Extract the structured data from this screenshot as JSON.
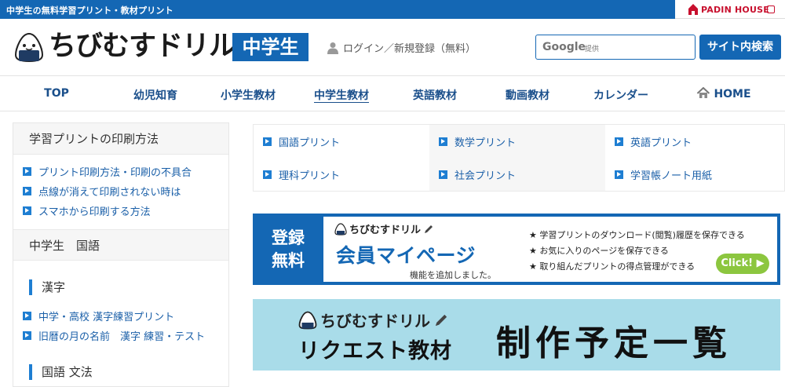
{
  "topbar": {
    "text": "中学生の無料学習プリント・教材プリント",
    "partner": "PADIN HOUSE"
  },
  "header": {
    "logo_text": "ちびむすドリル",
    "logo_badge": "中学生",
    "login_text": "ログイン／新規登録（無料）",
    "search_google": "Google",
    "search_provided": "提供",
    "search_button": "サイト内検索"
  },
  "nav": {
    "items": [
      "TOP",
      "幼児知育",
      "小学生教材",
      "中学生教材",
      "英語教材",
      "動画教材",
      "カレンダー",
      "HOME"
    ]
  },
  "sidebar": {
    "print_head": "学習プリントの印刷方法",
    "print_links": [
      "プリント印刷方法・印刷の不具合",
      "点線が消えて印刷されない時は",
      "スマホから印刷する方法"
    ],
    "subject_head": "中学生　国語",
    "kanji_title": "漢字",
    "kanji_links": [
      "中学・高校 漢字練習プリント",
      "旧暦の月の名前　漢字 練習・テスト"
    ],
    "grammar_title": "国語 文法"
  },
  "subjects": [
    "国語プリント",
    "数学プリント",
    "英語プリント",
    "理科プリント",
    "社会プリント",
    "学習帳ノート用紙"
  ],
  "banner_member": {
    "left_line1": "登録",
    "left_line2": "無料",
    "logo_text": "ちびむすドリル",
    "title": "会員マイページ",
    "caption": "機能を追加しました。",
    "features": [
      "★ 学習プリントのダウンロード(閲覧)履歴を保存できる",
      "★ お気に入りのページを保存できる",
      "★ 取り組んだプリントの得点管理ができる"
    ],
    "click_label": "Click! ▶"
  },
  "banner_request": {
    "logo_text": "ちびむすドリル",
    "title": "リクエスト教材",
    "big_text": "制作予定一覧"
  },
  "colors": {
    "brand_blue": "#1467b4",
    "link_blue": "#1a5fa8",
    "accent_green": "#8cc63f",
    "banner_sky": "#a9dce9"
  }
}
